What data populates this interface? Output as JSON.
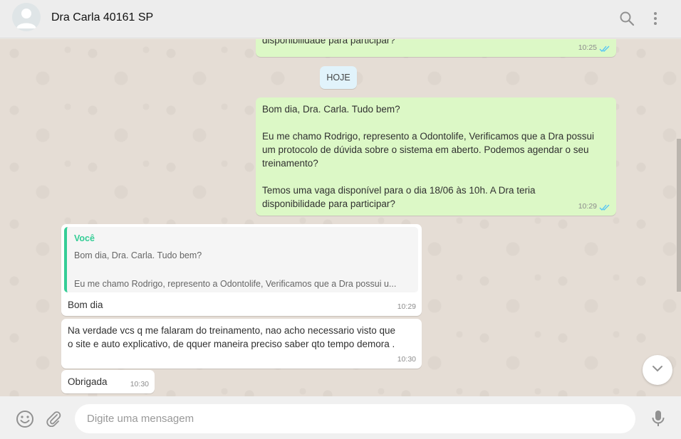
{
  "header": {
    "contact_name": "Dra Carla 40161 SP",
    "icons": [
      "search-icon",
      "menu-icon"
    ]
  },
  "chat": {
    "partial_out": {
      "text": "disponibilidade para participar?",
      "time": "10:25"
    },
    "day_label": "HOJE",
    "out_message": {
      "lines": [
        "Bom dia, Dra. Carla. Tudo bem?",
        "",
        "Eu me chamo Rodrigo, represento a Odontolife, Verificamos que a Dra possui",
        "um protocolo de dúvida sobre o sistema em aberto. Podemos agendar o seu",
        "treinamento?",
        "",
        "Temos uma vaga disponível para o dia 18/06 às 10h. A Dra teria",
        "disponibilidade para participar?"
      ],
      "time": "10:29"
    },
    "reply": {
      "quote_author": "Você",
      "quote_line1": "Bom dia, Dra. Carla. Tudo bem?",
      "quote_line2": "Eu me chamo Rodrigo, represento a Odontolife, Verificamos que a Dra possui u...",
      "text": "Bom dia",
      "time": "10:29"
    },
    "in_message2": {
      "line1": "Na verdade vcs q me falaram do treinamento, nao acho necessario visto que",
      "line2": "o site e auto explicativo, de qquer maneira preciso saber qto tempo demora .",
      "time": "10:30"
    },
    "in_message3": {
      "text": "Obrigada",
      "time": "10:30"
    }
  },
  "composer": {
    "placeholder": "Digite uma mensagem",
    "icons": [
      "emoji-icon",
      "attach-icon",
      "mic-icon"
    ]
  },
  "colors": {
    "outgoing_bubble": "#dcf8c6",
    "incoming_bubble": "#ffffff",
    "read_ticks": "#4fc3f7",
    "quote_accent": "#35cd96"
  }
}
